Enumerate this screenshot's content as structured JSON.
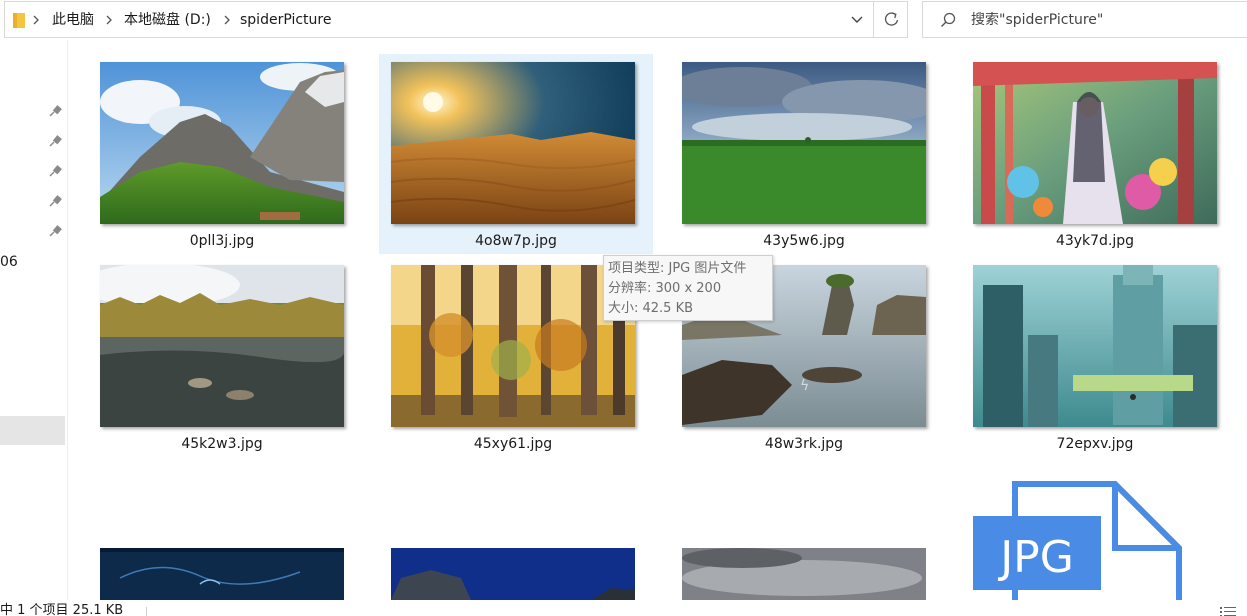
{
  "address_bar": {
    "breadcrumbs": [
      "此电脑",
      "本地磁盘 (D:)",
      "spiderPicture"
    ],
    "icon": "folder-icon"
  },
  "search": {
    "placeholder": "搜索\"spiderPicture\"",
    "icon": "search-icon"
  },
  "nav": {
    "pins": [
      "pin-icon",
      "pin-icon",
      "pin-icon",
      "pin-icon",
      "pin-icon"
    ],
    "partial_text": "06"
  },
  "files": [
    {
      "name": "0pll3j.jpg",
      "scene": "mountain"
    },
    {
      "name": "4o8w7p.jpg",
      "scene": "desert",
      "selected": true
    },
    {
      "name": "43y5w6.jpg",
      "scene": "field"
    },
    {
      "name": "43yk7d.jpg",
      "scene": "anime-forest"
    },
    {
      "name": "45k2w3.jpg",
      "scene": "river"
    },
    {
      "name": "45xy61.jpg",
      "scene": "autumn-forest"
    },
    {
      "name": "48w3rk.jpg",
      "scene": "sea-rocks"
    },
    {
      "name": "72epxv.jpg",
      "scene": "ruins"
    }
  ],
  "partial_row": [
    "dark-blue-thumbnail",
    "night-mountain-thumbnail",
    "cloudy-sky-thumbnail",
    "jpg-file-icon"
  ],
  "jpg_icon_label": "JPG",
  "tooltip": {
    "type_line": "项目类型: JPG 图片文件",
    "dimension_line": "分辨率: 300 x 200",
    "size_line": "大小: 42.5 KB"
  },
  "status_bar": {
    "text": "中 1 个项目  25.1 KB"
  },
  "colors": {
    "selection": "#e5f1fb",
    "accent": "#4a8be6",
    "tooltip_bg": "#f7f7f7"
  }
}
